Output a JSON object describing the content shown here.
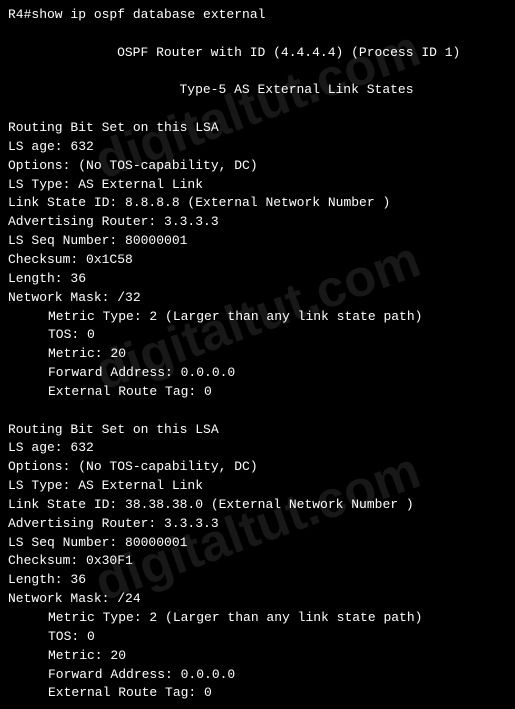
{
  "terminal": {
    "prompt": "R4#show ip ospf database external",
    "header1": "        OSPF Router with ID (4.4.4.4) (Process ID 1)",
    "header2": "          Type-5 AS External Link States",
    "block1": {
      "line1": "Routing Bit Set on this LSA",
      "line2": "LS age: 632",
      "line3": "Options: (No TOS-capability, DC)",
      "line4": "LS Type: AS External Link",
      "line5": "Link State ID: 8.8.8.8 (External Network Number )",
      "line6": "Advertising Router: 3.3.3.3",
      "line7": "LS Seq Number: 80000001",
      "line8": "Checksum: 0x1C58",
      "line9": "Length: 36",
      "line10": "Network Mask: /32",
      "indent1": "Metric Type: 2 (Larger than any link state path)",
      "indent2": "TOS: 0",
      "indent3": "Metric: 20",
      "indent4": "Forward Address: 0.0.0.0",
      "indent5": "External Route Tag: 0"
    },
    "block2": {
      "line1": "Routing Bit Set on this LSA",
      "line2": "LS age: 632",
      "line3": "Options: (No TOS-capability, DC)",
      "line4": "LS Type: AS External Link",
      "line5": "Link State ID: 38.38.38.0 (External Network Number )",
      "line6": "Advertising Router: 3.3.3.3",
      "line7": "LS Seq Number: 80000001",
      "line8": "Checksum: 0x30F1",
      "line9": "Length: 36",
      "line10": "Network Mask: /24",
      "indent1": "Metric Type: 2 (Larger than any link state path)",
      "indent2": "TOS: 0",
      "indent3": "Metric: 20",
      "indent4": "Forward Address: 0.0.0.0",
      "indent5": "External Route Tag: 0"
    }
  },
  "watermark": {
    "text": "digitaltut.com"
  }
}
